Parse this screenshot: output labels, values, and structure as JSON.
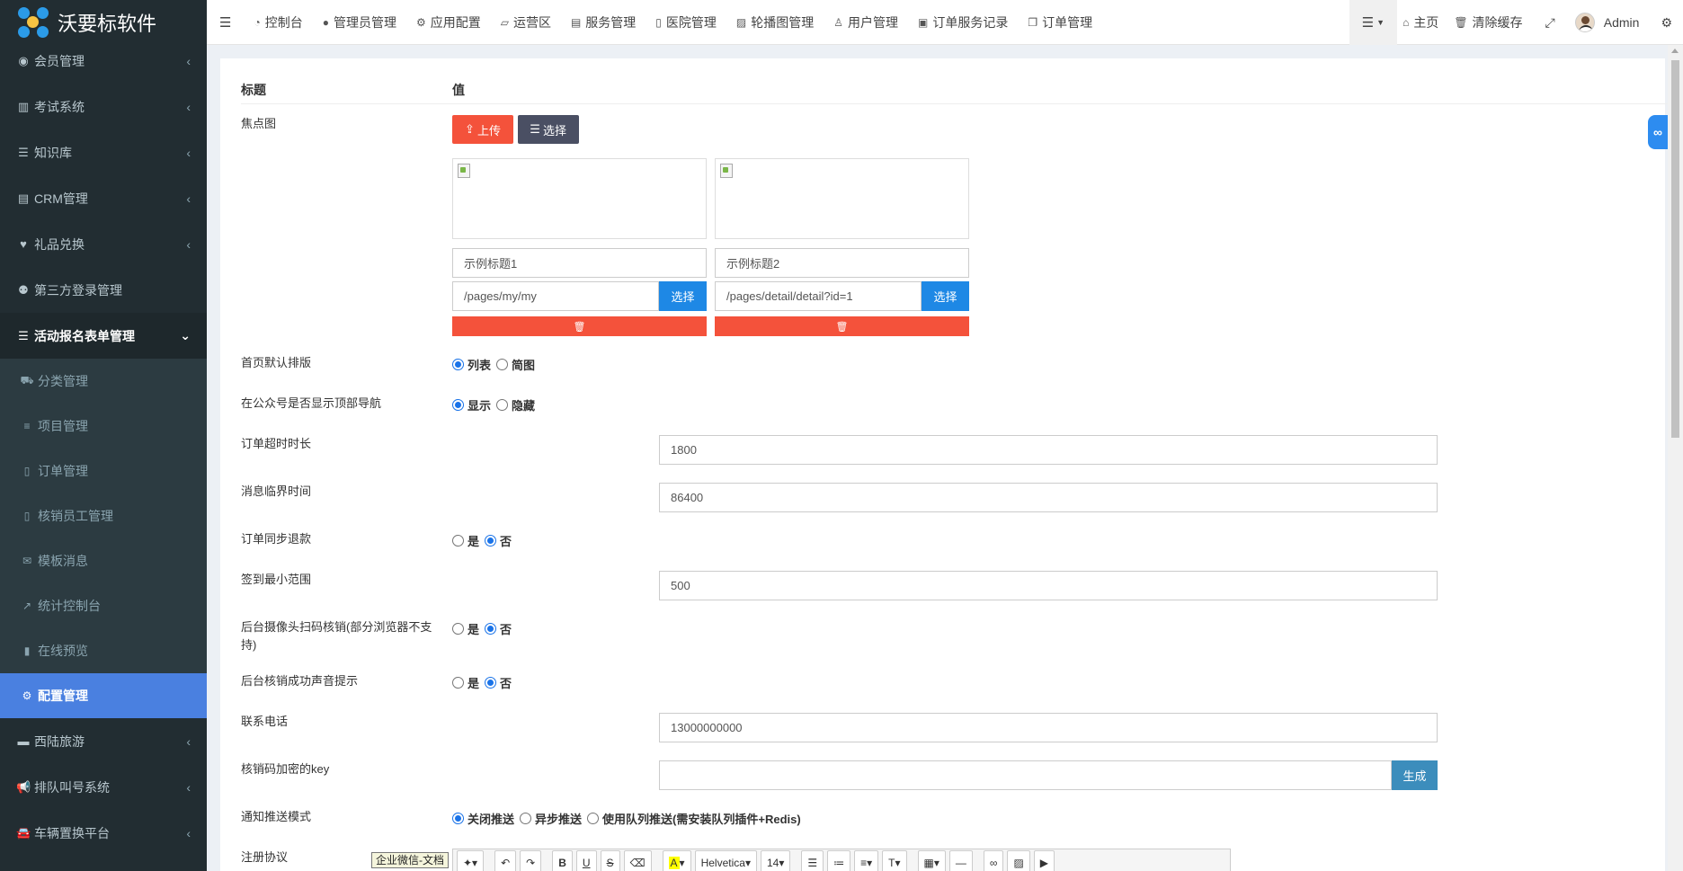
{
  "app": {
    "title": "沃要标软件"
  },
  "sidebar": {
    "items": [
      {
        "label": "会员管理",
        "icon": "user-circle-icon",
        "chev": "‹"
      },
      {
        "label": "考试系统",
        "icon": "columns-icon",
        "chev": "‹"
      },
      {
        "label": "知识库",
        "icon": "list-icon",
        "chev": "‹"
      },
      {
        "label": "CRM管理",
        "icon": "id-card-icon",
        "chev": "‹"
      },
      {
        "label": "礼品兑换",
        "icon": "heart-icon",
        "chev": "‹"
      },
      {
        "label": "第三方登录管理",
        "icon": "users-icon",
        "chev": ""
      },
      {
        "label": "活动报名表单管理",
        "icon": "list-icon",
        "chev": "⌄"
      }
    ],
    "subitems": [
      {
        "label": "分类管理",
        "icon": "cart-icon"
      },
      {
        "label": "项目管理",
        "icon": "bars-icon"
      },
      {
        "label": "订单管理",
        "icon": "file-icon"
      },
      {
        "label": "核销员工管理",
        "icon": "file-icon"
      },
      {
        "label": "模板消息",
        "icon": "envelope-icon"
      },
      {
        "label": "统计控制台",
        "icon": "chart-line-icon"
      },
      {
        "label": "在线预览",
        "icon": "mobile-icon"
      },
      {
        "label": "配置管理",
        "icon": "gears-icon"
      }
    ],
    "bottom_items": [
      {
        "label": "西陆旅游",
        "icon": "folder-icon",
        "chev": "‹"
      },
      {
        "label": "排队叫号系统",
        "icon": "bullhorn-icon",
        "chev": "‹"
      },
      {
        "label": "车辆置换平台",
        "icon": "car-icon",
        "chev": "‹"
      }
    ]
  },
  "topbar": {
    "nav": [
      {
        "label": "控制台",
        "icon": "dashboard-icon"
      },
      {
        "label": "管理员管理",
        "icon": "user-icon"
      },
      {
        "label": "应用配置",
        "icon": "gear-icon"
      },
      {
        "label": "运营区",
        "icon": "map-icon"
      },
      {
        "label": "服务管理",
        "icon": "list-alt-icon"
      },
      {
        "label": "医院管理",
        "icon": "clipboard-icon"
      },
      {
        "label": "轮播图管理",
        "icon": "image-icon"
      },
      {
        "label": "用户管理",
        "icon": "user-outline-icon"
      },
      {
        "label": "订单服务记录",
        "icon": "save-icon"
      },
      {
        "label": "订单管理",
        "icon": "copy-icon"
      }
    ],
    "home": "主页",
    "clear_cache": "清除缓存",
    "user": "Admin"
  },
  "table": {
    "col_title": "标题",
    "col_value": "值"
  },
  "form": {
    "focus_label": "焦点图",
    "upload_btn": "上传",
    "select_btn": "选择",
    "cards": [
      {
        "title": "示例标题1",
        "path": "/pages/my/my",
        "select": "选择"
      },
      {
        "title": "示例标题2",
        "path": "/pages/detail/detail?id=1",
        "select": "选择"
      }
    ],
    "layout_label": "首页默认排版",
    "layout_options": [
      "列表",
      "简图"
    ],
    "topnav_label": "在公众号是否显示顶部导航",
    "topnav_options": [
      "显示",
      "隐藏"
    ],
    "timeout_label": "订单超时时长",
    "timeout_value": "1800",
    "msg_label": "消息临界时间",
    "msg_value": "86400",
    "refund_label": "订单同步退款",
    "yes": "是",
    "no": "否",
    "sign_label": "签到最小范围",
    "sign_value": "500",
    "camera_label": "后台摄像头扫码核销(部分浏览器不支持)",
    "sound_label": "后台核销成功声音提示",
    "phone_label": "联系电话",
    "phone_value": "13000000000",
    "key_label": "核销码加密的key",
    "key_value": "",
    "generate_btn": "生成",
    "push_label": "通知推送模式",
    "push_options": [
      "关闭推送",
      "异步推送",
      "使用队列推送(需安装队列插件+Redis)"
    ],
    "agreement_label": "注册协议",
    "tooltip": "企业微信-文档",
    "editor_font": "Helvetica",
    "editor_size": "14"
  },
  "colors": {
    "accent": "#4a80e0",
    "danger": "#f4523b",
    "primary": "#1e88e5",
    "dark": "#4a4f63"
  }
}
